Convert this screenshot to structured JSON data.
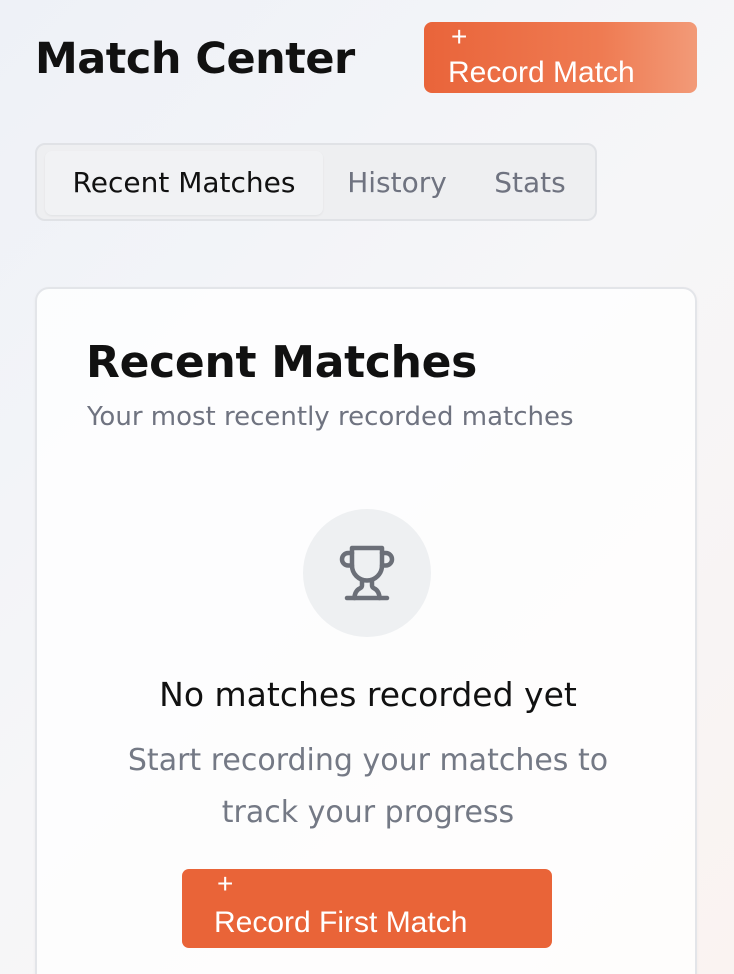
{
  "header": {
    "title": "Match Center",
    "record_button": {
      "icon": "plus-icon",
      "plus": "+",
      "label": "Record Match"
    }
  },
  "tabs": [
    {
      "label": "Recent Matches",
      "active": true
    },
    {
      "label": "History",
      "active": false
    },
    {
      "label": "Stats",
      "active": false
    }
  ],
  "card": {
    "title": "Recent Matches",
    "subtitle": "Your most recently recorded matches",
    "empty_state": {
      "icon": "trophy-icon",
      "title": "No matches recorded yet",
      "description": "Start recording your matches to track your progress",
      "button": {
        "icon": "plus-icon",
        "plus": "+",
        "label": "Record First Match"
      }
    }
  },
  "colors": {
    "accent": "#e96438",
    "muted_text": "#6f7380",
    "icon": "#6b6f78"
  }
}
